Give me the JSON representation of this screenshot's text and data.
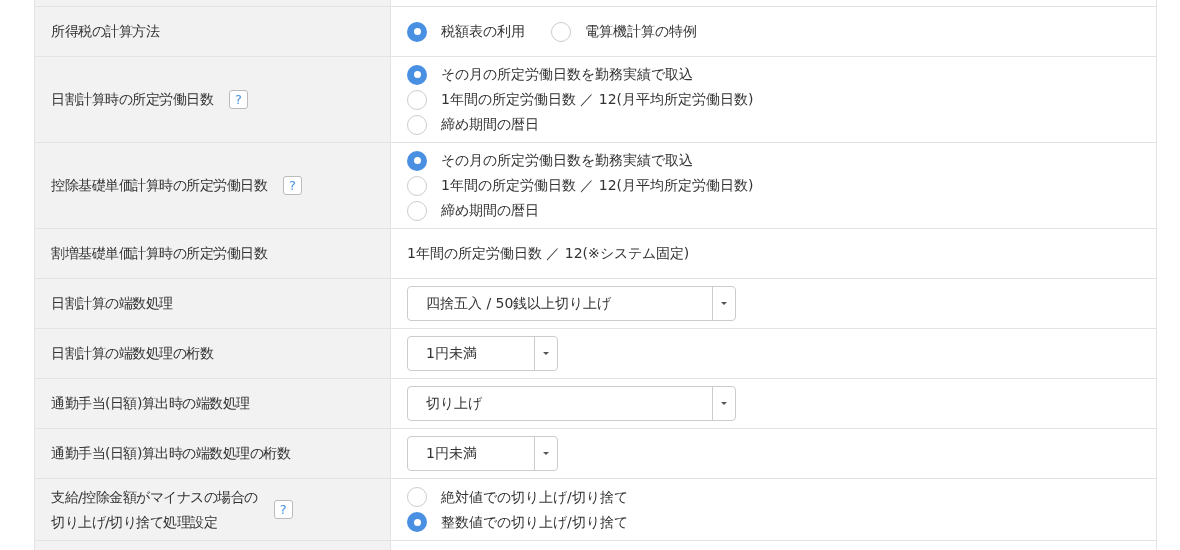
{
  "rows": [
    {
      "label": "所得税の計算方法",
      "kind": "radio",
      "inline": true,
      "options": [
        {
          "label": "税額表の利用",
          "selected": true
        },
        {
          "label": "電算機計算の特例",
          "selected": false
        }
      ]
    },
    {
      "label": "日割計算時の所定労働日数",
      "help": "?",
      "kind": "radio",
      "inline": false,
      "options": [
        {
          "label": "その月の所定労働日数を勤務実績で取込",
          "selected": true
        },
        {
          "label": "1年間の所定労働日数 ／ 12(月平均所定労働日数)",
          "selected": false
        },
        {
          "label": "締め期間の暦日",
          "selected": false
        }
      ]
    },
    {
      "label": "控除基礎単価計算時の所定労働日数",
      "help": "?",
      "kind": "radio",
      "inline": false,
      "options": [
        {
          "label": "その月の所定労働日数を勤務実績で取込",
          "selected": true
        },
        {
          "label": "1年間の所定労働日数 ／ 12(月平均所定労働日数)",
          "selected": false
        },
        {
          "label": "締め期間の暦日",
          "selected": false
        }
      ]
    },
    {
      "label": "割増基礎単価計算時の所定労働日数",
      "kind": "text",
      "value": "1年間の所定労働日数 ／ 12(※システム固定)"
    },
    {
      "label": "日割計算の端数処理",
      "kind": "select",
      "wide": true,
      "value": "四捨五入 / 50銭以上切り上げ"
    },
    {
      "label": "日割計算の端数処理の桁数",
      "kind": "select",
      "wide": false,
      "value": "1円未満"
    },
    {
      "label": "通勤手当(日額)算出時の端数処理",
      "kind": "select",
      "wide": true,
      "value": "切り上げ"
    },
    {
      "label": "通勤手当(日額)算出時の端数処理の桁数",
      "kind": "select",
      "wide": false,
      "value": "1円未満"
    },
    {
      "label_lines": [
        "支給/控除金額がマイナスの場合の",
        "切り上げ/切り捨て処理設定"
      ],
      "help": "?",
      "kind": "radio",
      "inline": false,
      "options": [
        {
          "label": "絶対値での切り上げ/切り捨て",
          "selected": false
        },
        {
          "label": "整数値での切り上げ/切り捨て",
          "selected": true
        }
      ]
    }
  ]
}
